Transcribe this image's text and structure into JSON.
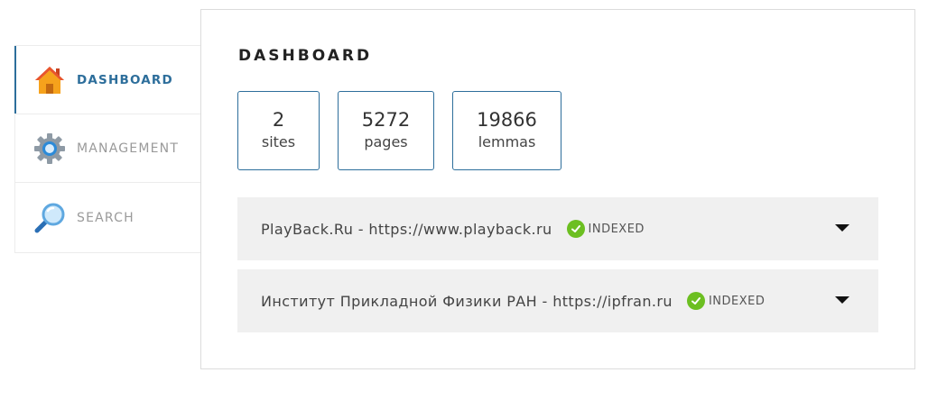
{
  "sidebar": {
    "items": [
      {
        "label": "DASHBOARD",
        "icon": "home-icon",
        "active": true
      },
      {
        "label": "MANAGEMENT",
        "icon": "gear-icon",
        "active": false
      },
      {
        "label": "SEARCH",
        "icon": "magnifier-icon",
        "active": false
      }
    ]
  },
  "dashboard": {
    "title": "DASHBOARD",
    "stats": [
      {
        "value": "2",
        "label": "sites"
      },
      {
        "value": "5272",
        "label": "pages"
      },
      {
        "value": "19866",
        "label": "lemmas"
      }
    ],
    "sites": [
      {
        "name": "PlayBack.Ru - https://www.playback.ru",
        "status": "INDEXED"
      },
      {
        "name": "Институт Прикладной Физики РАН - https://ipfran.ru",
        "status": "INDEXED"
      }
    ]
  },
  "colors": {
    "accent": "#2d6e9b",
    "status_ok": "#6cbf21",
    "row_bg": "#f0f0f0"
  }
}
